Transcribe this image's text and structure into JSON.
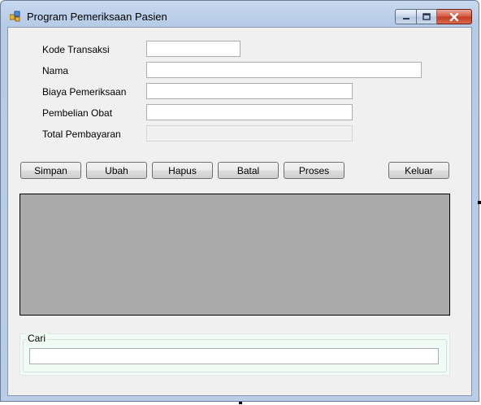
{
  "window": {
    "title": "Program Pemeriksaan Pasien"
  },
  "form": {
    "fields": [
      {
        "label": "Kode Transaksi",
        "value": "",
        "placeholder": ""
      },
      {
        "label": "Nama",
        "value": "",
        "placeholder": ""
      },
      {
        "label": "Biaya Pemeriksaan",
        "value": "",
        "placeholder": ""
      },
      {
        "label": "Pembelian Obat",
        "value": "",
        "placeholder": ""
      },
      {
        "label": "Total Pembayaran",
        "value": "",
        "placeholder": ""
      }
    ]
  },
  "buttons": {
    "simpan": "Simpan",
    "ubah": "Ubah",
    "hapus": "Hapus",
    "batal": "Batal",
    "proses": "Proses",
    "keluar": "Keluar"
  },
  "search": {
    "group_title": "Cari",
    "value": "",
    "placeholder": ""
  },
  "colors": {
    "window_frame": "#b9cde8",
    "client_background": "#f0f0f0",
    "grid_background": "#ababab",
    "search_group_background": "#f0fbf6",
    "close_button": "#c13a22"
  },
  "icons": {
    "app": "application-icon",
    "minimize": "minimize-icon",
    "maximize": "maximize-icon",
    "close": "close-icon"
  }
}
